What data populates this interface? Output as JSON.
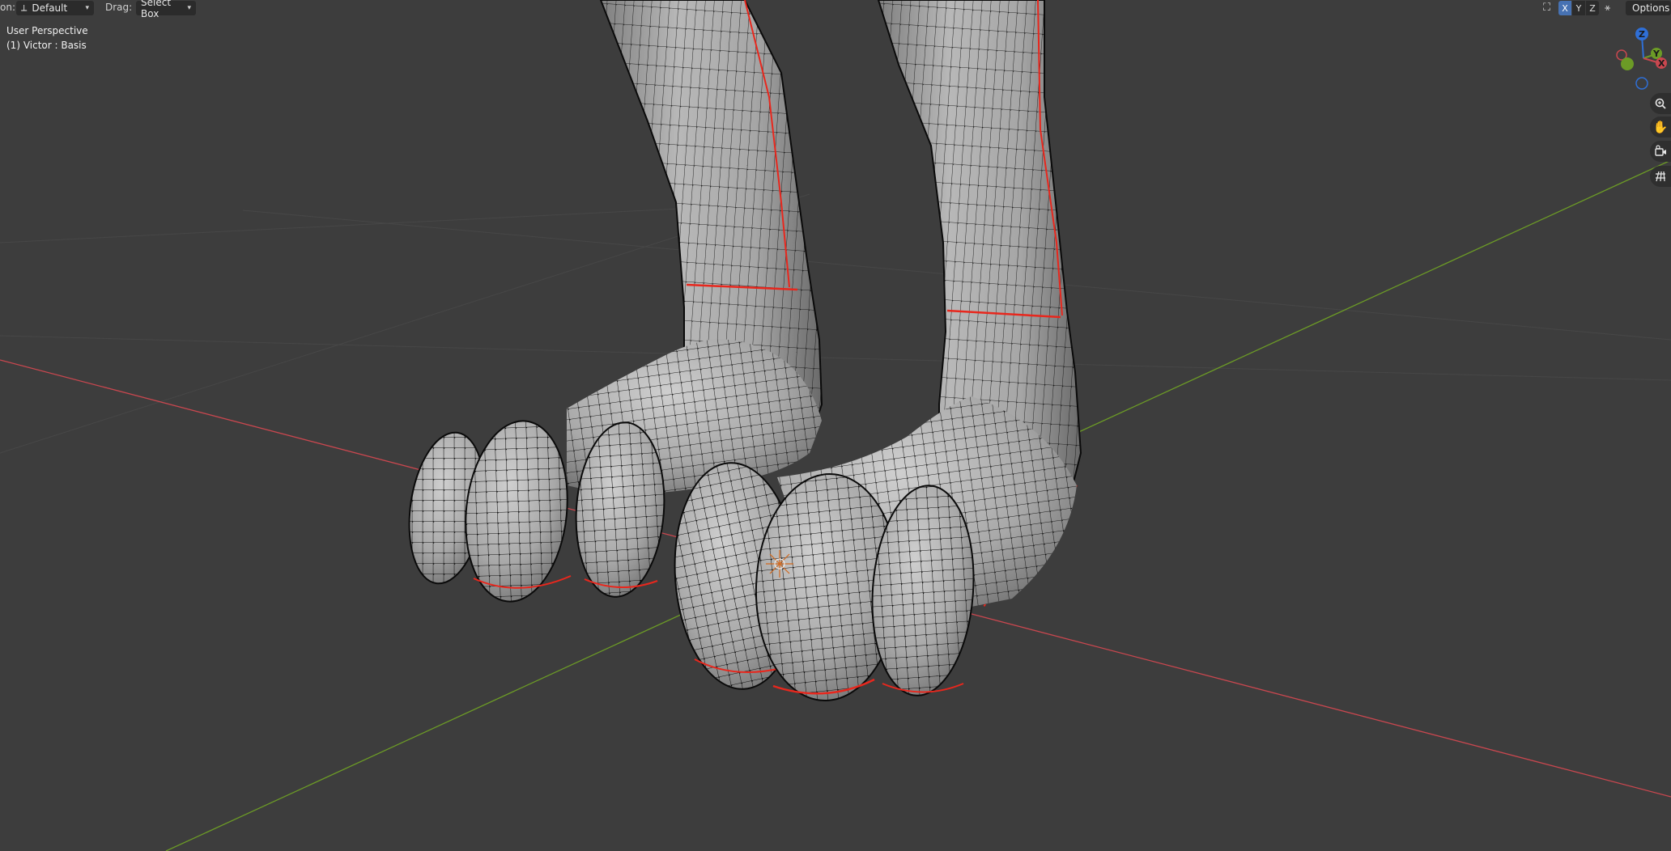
{
  "header": {
    "orientation_label": "on:",
    "orientation_value": "Default",
    "drag_label": "Drag:",
    "drag_value": "Select Box",
    "axis_buttons": [
      "X",
      "Y",
      "Z"
    ],
    "options_label": "Options"
  },
  "viewport_info": {
    "perspective": "User Perspective",
    "object": "(1) Victor : Basis"
  },
  "gizmo": {
    "x": "X",
    "y": "Y",
    "z": "Z"
  },
  "icons": {
    "orientation": "transform-orientation-icon",
    "mirror": "mirror-icon",
    "zoom": "zoom-icon",
    "pan": "hand-pan-icon",
    "camera": "camera-view-icon",
    "grid": "ortho-grid-icon"
  },
  "colors": {
    "viewport_bg": "#3d3d3d",
    "x_axis": "#c9474f",
    "y_axis": "#6c9b26",
    "z_axis": "#2f6fd6",
    "seam": "#e8271d",
    "mesh_fill": "#a9a9a9",
    "wire": "#0d0d0d",
    "active_button": "#4772b3"
  }
}
